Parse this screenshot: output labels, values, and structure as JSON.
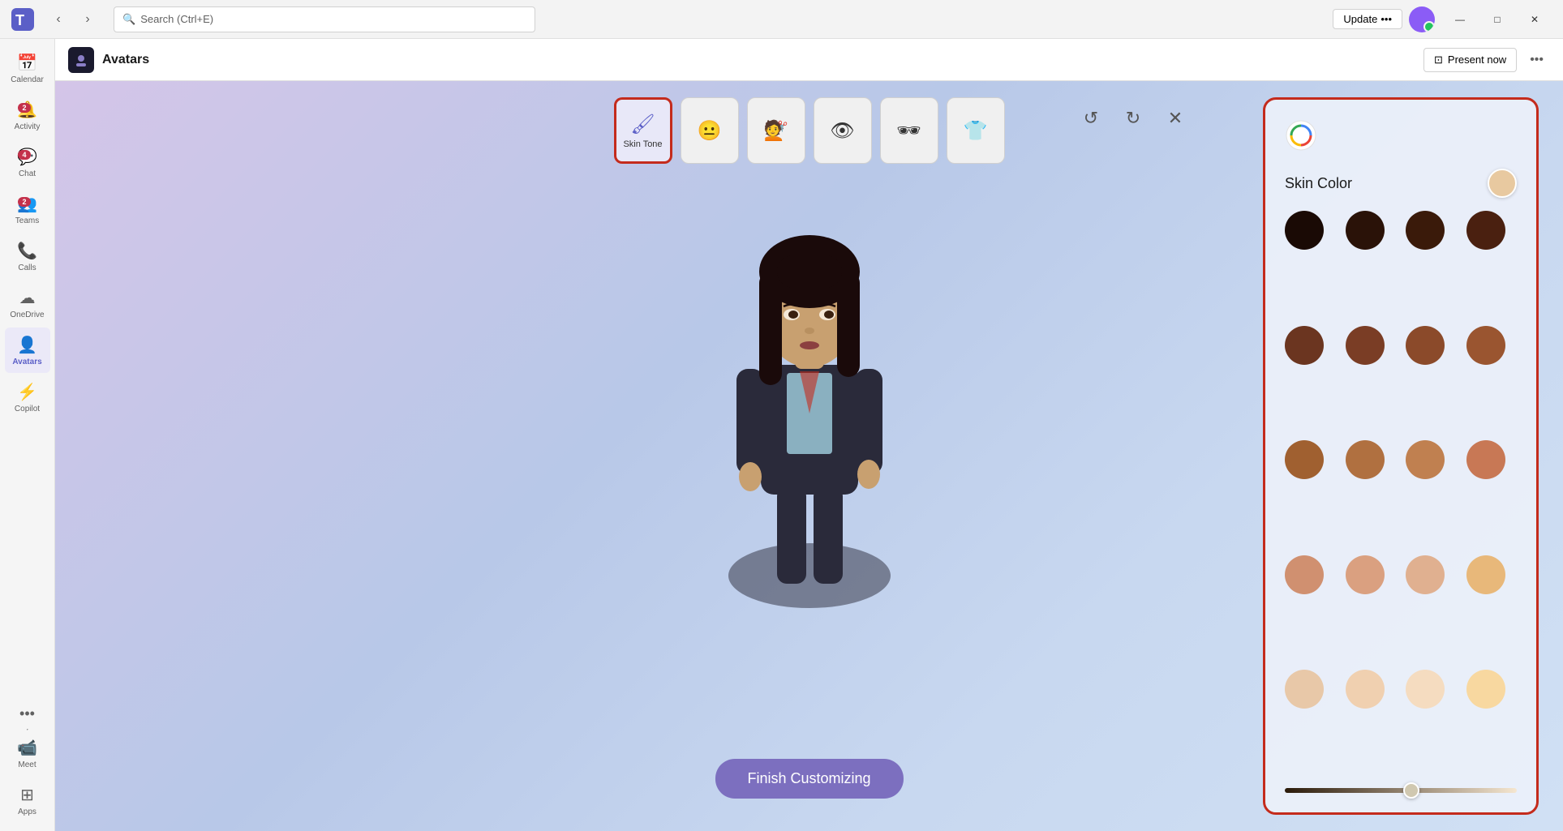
{
  "titleBar": {
    "searchPlaceholder": "Search (Ctrl+E)",
    "updateLabel": "Update",
    "updateEllipsis": "•••",
    "minimizeIcon": "—",
    "maximizeIcon": "□",
    "closeIcon": "✕"
  },
  "sidebar": {
    "items": [
      {
        "id": "calendar",
        "label": "Calendar",
        "icon": "📅",
        "badge": null,
        "active": false
      },
      {
        "id": "activity",
        "label": "Activity",
        "icon": "🔔",
        "badge": "2",
        "active": false
      },
      {
        "id": "chat",
        "label": "Chat",
        "icon": "💬",
        "badge": "4",
        "active": false
      },
      {
        "id": "teams",
        "label": "Teams",
        "icon": "👥",
        "badge": "2",
        "active": false
      },
      {
        "id": "calls",
        "label": "Calls",
        "icon": "📞",
        "badge": null,
        "active": false
      },
      {
        "id": "onedrive",
        "label": "OneDrive",
        "icon": "☁️",
        "badge": null,
        "active": false
      },
      {
        "id": "avatars",
        "label": "Avatars",
        "icon": "👤",
        "badge": null,
        "active": true
      },
      {
        "id": "copilot",
        "label": "Copilot",
        "icon": "⚡",
        "badge": null,
        "active": false
      },
      {
        "id": "meet",
        "label": "Meet",
        "icon": "📹",
        "badge": null,
        "active": false
      },
      {
        "id": "apps",
        "label": "Apps",
        "icon": "⊞",
        "badge": null,
        "active": false
      }
    ]
  },
  "appHeader": {
    "title": "Avatars",
    "presentNow": "Present now",
    "moreIcon": "•••"
  },
  "toolbar": {
    "buttons": [
      {
        "id": "skin-tone",
        "label": "Skin Tone",
        "icon": "🎨",
        "active": true
      },
      {
        "id": "face",
        "label": "",
        "icon": "😊",
        "active": false
      },
      {
        "id": "hair",
        "label": "",
        "icon": "💇",
        "active": false
      },
      {
        "id": "facial-features",
        "label": "",
        "icon": "👤",
        "active": false
      },
      {
        "id": "accessories",
        "label": "",
        "icon": "🎩",
        "active": false
      },
      {
        "id": "clothing",
        "label": "",
        "icon": "👕",
        "active": false
      }
    ],
    "undoLabel": "Undo",
    "redoLabel": "Redo",
    "closeLabel": "Close"
  },
  "finishButton": {
    "label": "Finish Customizing"
  },
  "skinPanel": {
    "title": "Skin Color",
    "previewColor": "#e8c9a0",
    "sliderValue": 55,
    "colors": [
      "#1a0a05",
      "#2a1208",
      "#3a1a0a",
      "#4a2010",
      "#6b3520",
      "#7a3d25",
      "#8b4a2a",
      "#9a5530",
      "#a06030",
      "#b07040",
      "#c08050",
      "#c87855",
      "#d09070",
      "#daa080",
      "#e0b090",
      "#e8b87a",
      "#e8c8a8",
      "#f0d0b0",
      "#f5dcc0",
      "#f8d8a0"
    ]
  }
}
